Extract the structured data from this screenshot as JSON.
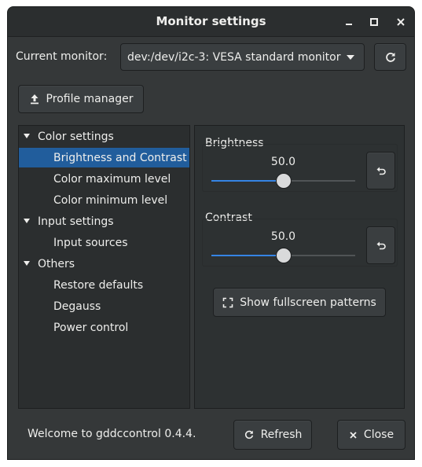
{
  "window": {
    "title": "Monitor settings"
  },
  "header": {
    "current_monitor_label": "Current monitor:",
    "monitor_value": "dev:/dev/i2c-3: VESA standard monitor"
  },
  "toolbar": {
    "profile_manager_label": "Profile manager"
  },
  "tree": {
    "items": [
      {
        "label": "Color settings",
        "level": 0,
        "expanded": true
      },
      {
        "label": "Brightness and Contrast",
        "level": 1,
        "selected": true
      },
      {
        "label": "Color maximum level",
        "level": 1
      },
      {
        "label": "Color minimum level",
        "level": 1
      },
      {
        "label": "Input settings",
        "level": 0,
        "expanded": true
      },
      {
        "label": "Input sources",
        "level": 1
      },
      {
        "label": "Others",
        "level": 0,
        "expanded": true
      },
      {
        "label": "Restore defaults",
        "level": 1
      },
      {
        "label": "Degauss",
        "level": 1
      },
      {
        "label": "Power control",
        "level": 1
      }
    ]
  },
  "controls": {
    "brightness": {
      "label": "Brightness",
      "value": "50.0",
      "fraction": 0.5
    },
    "contrast": {
      "label": "Contrast",
      "value": "50.0",
      "fraction": 0.5
    },
    "fullscreen_patterns_label": "Show fullscreen patterns"
  },
  "footer": {
    "status_text": "Welcome to gddccontrol 0.4.4.",
    "refresh_label": "Refresh",
    "close_label": "Close"
  },
  "colors": {
    "window_bg": "#353839",
    "selection": "#215d9c",
    "slider_accent": "#3584e4"
  }
}
